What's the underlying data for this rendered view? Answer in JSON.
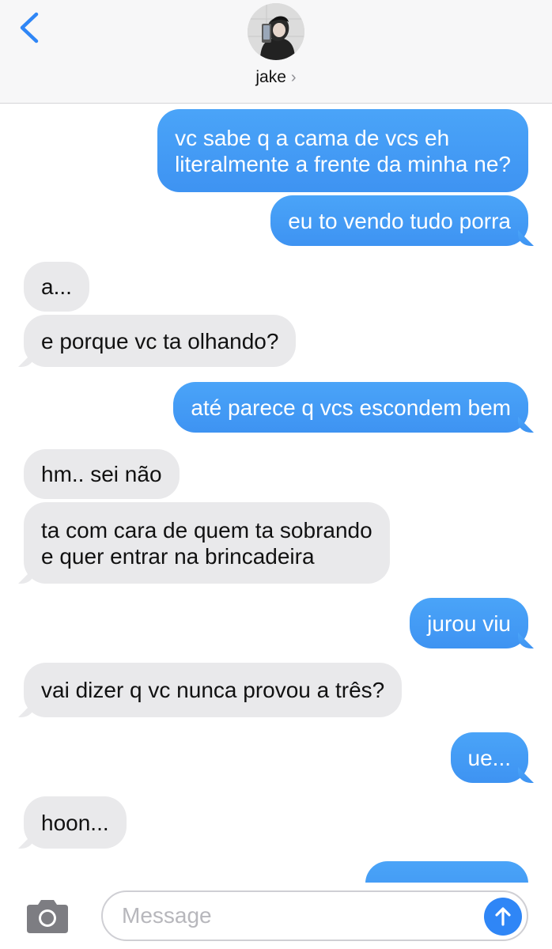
{
  "header": {
    "contact_name": "jake",
    "chevron": "›",
    "back_icon": "chevron-left-icon",
    "accent_color": "#2f86f6"
  },
  "messages": [
    {
      "direction": "out",
      "text": "vc sabe q a cama de vcs eh\nliteralmente a frente da minha ne?"
    },
    {
      "direction": "out",
      "text": "eu to vendo tudo porra"
    },
    {
      "direction": "in",
      "text": "a..."
    },
    {
      "direction": "in",
      "text": "e porque vc ta olhando?"
    },
    {
      "direction": "out",
      "text": "até parece q vcs escondem bem"
    },
    {
      "direction": "in",
      "text": "hm.. sei não"
    },
    {
      "direction": "in",
      "text": "ta com cara de quem ta sobrando\ne quer entrar na brincadeira"
    },
    {
      "direction": "out",
      "text": "jurou viu"
    },
    {
      "direction": "in",
      "text": "vai dizer q vc nunca provou a três?"
    },
    {
      "direction": "out",
      "text": "ue..."
    },
    {
      "direction": "in",
      "text": "hoon..."
    }
  ],
  "composer": {
    "placeholder": "Message",
    "value": "",
    "camera_icon": "camera-icon",
    "send_icon": "send-arrow-up-icon"
  },
  "colors": {
    "outgoing_bubble": "#3e93f2",
    "incoming_bubble": "#e9e9eb",
    "header_bg": "#f7f7f8"
  }
}
